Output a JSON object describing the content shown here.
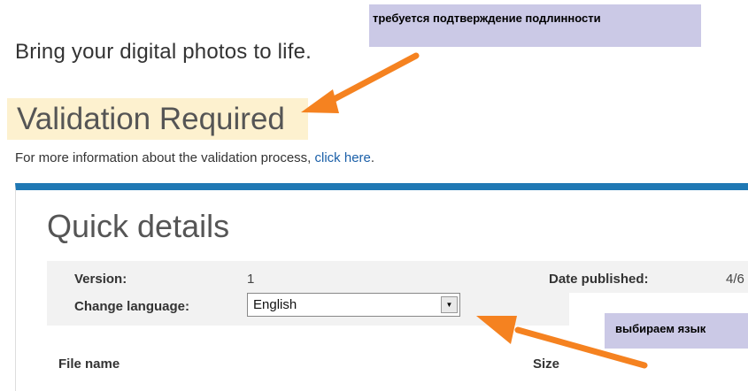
{
  "tagline": "Bring your digital photos to life.",
  "validation": {
    "title": "Validation Required",
    "info_text": "For more information about the validation process, ",
    "info_link": "click here",
    "info_suffix": "."
  },
  "callouts": {
    "auth": "требуется подтверждение подлинности",
    "lang": "выбираем язык"
  },
  "quick_details": {
    "title": "Quick details",
    "version_label": "Version:",
    "version_value": "1",
    "date_label": "Date published:",
    "date_value": "4/6",
    "language_label": "Change language:",
    "language_selected": "English",
    "dropdown_glyph": "▼"
  },
  "table": {
    "headers": [
      "File name",
      "Size"
    ]
  },
  "colors": {
    "accent_bar": "#1f78b4",
    "highlight": "#fdf1cf",
    "callout_bg": "#cbc9e6",
    "arrow": "#f58220",
    "link": "#1a5fa8"
  }
}
